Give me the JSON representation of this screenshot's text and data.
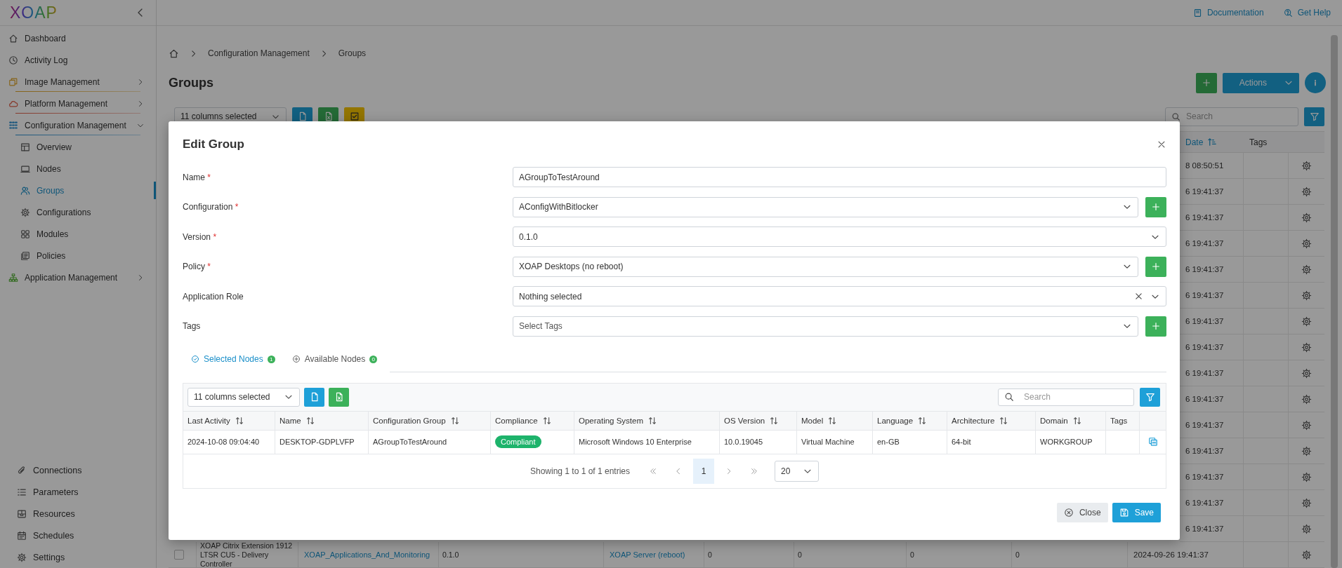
{
  "sidebar": {
    "logo": "XOAP",
    "items": [
      {
        "label": "Dashboard",
        "selected": false
      },
      {
        "label": "Activity Log",
        "selected": false
      },
      {
        "label": "Image Management",
        "selected": false,
        "expanded": false
      },
      {
        "label": "Platform Management",
        "selected": false,
        "expanded": false
      },
      {
        "label": "Configuration Management",
        "selected": false,
        "expanded": true,
        "children": [
          {
            "label": "Overview",
            "selected": false
          },
          {
            "label": "Nodes",
            "selected": false
          },
          {
            "label": "Groups",
            "selected": true
          },
          {
            "label": "Configurations",
            "selected": false
          },
          {
            "label": "Modules",
            "selected": false
          },
          {
            "label": "Policies",
            "selected": false
          }
        ]
      },
      {
        "label": "Application Management",
        "selected": false,
        "expanded": false
      }
    ],
    "bottom_items": [
      {
        "label": "Connections",
        "selected": false
      },
      {
        "label": "Parameters",
        "selected": false
      },
      {
        "label": "Resources",
        "selected": false
      },
      {
        "label": "Schedules",
        "selected": false
      },
      {
        "label": "Settings",
        "selected": false
      }
    ]
  },
  "header_links": [
    {
      "label": "Documentation"
    },
    {
      "label": "Get Help"
    }
  ],
  "breadcrumb": [
    "Configuration Management",
    "Groups"
  ],
  "page_title": "Groups",
  "actions_button": "Actions",
  "toolbar": {
    "columns_select": "11 columns selected",
    "search_placeholder": "Search"
  },
  "table": {
    "columns": [
      {
        "label": "Date",
        "sorted": true
      },
      {
        "label": "Tags"
      }
    ],
    "rows": [
      {
        "kind": "partial",
        "date": "8 08:50:51"
      },
      {
        "kind": "partial",
        "date": "6 19:41:37"
      },
      {
        "kind": "partial",
        "date": "6 19:41:37"
      },
      {
        "kind": "partial",
        "date": "6 19:41:37"
      },
      {
        "kind": "partial",
        "date": "6 19:41:37"
      },
      {
        "kind": "partial",
        "date": "6 19:41:37"
      },
      {
        "kind": "partial",
        "date": "6 19:41:37"
      },
      {
        "kind": "partial",
        "date": "6 19:41:37"
      },
      {
        "kind": "partial",
        "date": "6 19:41:37"
      },
      {
        "kind": "partial",
        "date": "6 19:41:37"
      },
      {
        "kind": "partial",
        "date": "6 19:41:37"
      },
      {
        "kind": "partial",
        "date": "6 19:41:37"
      },
      {
        "kind": "partial",
        "date": "6 19:41:37"
      },
      {
        "kind": "partial",
        "date": "6 19:41:37"
      },
      {
        "kind": "partial",
        "date": "6 19:41:37"
      },
      {
        "kind": "full",
        "checked": false,
        "date": "2024-09-26 19:41:37",
        "cells": [
          {
            "text": "XOAP Citrix Extension 1912 LTSR CU5 - Delivery Controller",
            "link": false
          },
          {
            "text": "XOAP_Applications_And_Monitoring",
            "link": true
          },
          {
            "text": "0.1.0",
            "link": false
          },
          {
            "text": "XOAP Server (reboot)",
            "link": true
          },
          {
            "text": "0",
            "link": false
          },
          {
            "text": "0",
            "link": false
          },
          {
            "text": "0",
            "link": false
          },
          {
            "text": "0",
            "link": false
          }
        ]
      }
    ]
  },
  "dialog": {
    "title": "Edit Group",
    "fields": [
      {
        "label": "Name",
        "required_mark": "*",
        "kind": "text",
        "value": "AGroupToTestAround"
      },
      {
        "label": "Configuration",
        "required_mark": "*",
        "kind": "select",
        "value": "AConfigWithBitlocker",
        "add_button": true
      },
      {
        "label": "Version",
        "required_mark": "*",
        "kind": "select",
        "value": "0.1.0"
      },
      {
        "label": "Policy",
        "required_mark": "*",
        "kind": "select",
        "value": "XOAP Desktops (no reboot)",
        "add_button": true
      },
      {
        "label": "Application Role",
        "kind": "select",
        "value": "Nothing selected",
        "clearable": true
      },
      {
        "label": "Tags",
        "kind": "select",
        "placeholder": "Select Tags",
        "add_button": true
      }
    ],
    "tabs": [
      {
        "label": "Selected Nodes",
        "count": "1",
        "selected": true
      },
      {
        "label": "Available Nodes",
        "count": "0",
        "selected": false
      }
    ],
    "nodes": {
      "columns_select": "11 columns selected",
      "search_placeholder": "Search",
      "columns": [
        {
          "label": "Last Activity",
          "sortable": true,
          "kind": "text"
        },
        {
          "label": "Name",
          "sortable": true,
          "kind": "text"
        },
        {
          "label": "Configuration Group",
          "sortable": true,
          "kind": "text"
        },
        {
          "label": "Compliance",
          "sortable": true,
          "kind": "badge"
        },
        {
          "label": "Operating System",
          "sortable": true,
          "kind": "text"
        },
        {
          "label": "OS Version",
          "sortable": true,
          "kind": "text"
        },
        {
          "label": "Model",
          "sortable": true,
          "kind": "text"
        },
        {
          "label": "Language",
          "sortable": true,
          "kind": "text"
        },
        {
          "label": "Architecture",
          "sortable": true,
          "kind": "text"
        },
        {
          "label": "Domain",
          "sortable": true,
          "kind": "text"
        },
        {
          "label": "Tags",
          "kind": "text"
        }
      ],
      "rows": [
        {
          "cells": [
            "2024-10-08 09:04:40",
            "DESKTOP-GDPLVFP",
            "AGroupToTestAround",
            "Compliant",
            "Microsoft Windows 10 Enterprise",
            "10.0.19045",
            "Virtual Machine",
            "en-GB",
            "64-bit",
            "WORKGROUP"
          ]
        }
      ],
      "pagination": {
        "summary": "Showing 1 to 1 of 1 entries",
        "pages": [
          {
            "label": "1",
            "selected": true
          }
        ],
        "page_size": "20"
      }
    },
    "buttons": [
      {
        "label": "Close",
        "kind": "secondary"
      },
      {
        "label": "Save",
        "kind": "primary"
      }
    ]
  }
}
